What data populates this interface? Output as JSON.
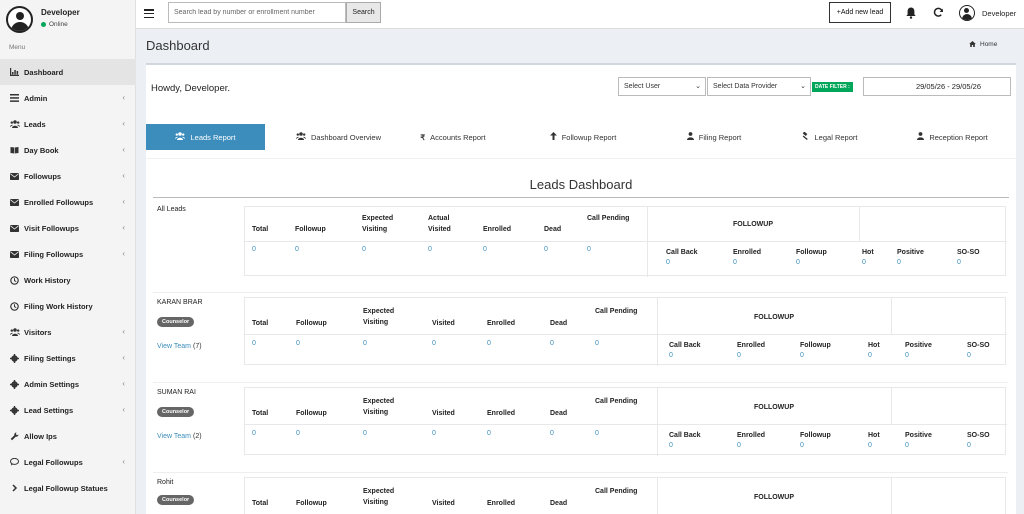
{
  "user": {
    "name": "Developer",
    "status": "Online"
  },
  "menu_header": "Menu",
  "sidebar": {
    "items": [
      {
        "label": "Dashboard",
        "icon": "dashboard-icon",
        "active": true,
        "chevron": false
      },
      {
        "label": "Admin",
        "icon": "list-icon",
        "chevron": true
      },
      {
        "label": "Leads",
        "icon": "users-icon",
        "chevron": true
      },
      {
        "label": "Day Book",
        "icon": "book-icon",
        "chevron": true
      },
      {
        "label": "Followups",
        "icon": "envelope-icon",
        "chevron": true
      },
      {
        "label": "Enrolled Followups",
        "icon": "envelope-icon",
        "chevron": true
      },
      {
        "label": "Visit Followups",
        "icon": "envelope-icon",
        "chevron": true
      },
      {
        "label": "Filing Followups",
        "icon": "envelope-icon",
        "chevron": true
      },
      {
        "label": "Work History",
        "icon": "clock-icon",
        "chevron": false
      },
      {
        "label": "Filing Work History",
        "icon": "clock-icon",
        "chevron": false
      },
      {
        "label": "Visitors",
        "icon": "users-icon",
        "chevron": true
      },
      {
        "label": "Filing Settings",
        "icon": "gear-icon",
        "chevron": true
      },
      {
        "label": "Admin Settings",
        "icon": "gear-icon",
        "chevron": true
      },
      {
        "label": "Lead Settings",
        "icon": "gear-icon",
        "chevron": true
      },
      {
        "label": "Allow Ips",
        "icon": "wrench-icon",
        "chevron": false
      },
      {
        "label": "Legal Followups",
        "icon": "comment-icon",
        "chevron": true
      },
      {
        "label": "Legal Followup Statues",
        "icon": "chevron-right-icon",
        "chevron": false
      }
    ]
  },
  "topbar": {
    "search_placeholder": "Search lead by number or enrollment number",
    "search_label": "Search",
    "add_lead_label": "+Add new lead",
    "user_label": "Developer"
  },
  "page": {
    "title": "Dashboard",
    "breadcrumb": "Home"
  },
  "filters": {
    "greeting": "Howdy, Developer.",
    "select_user": "Select User",
    "select_provider": "Select Data Provider",
    "date_filter_label": "DATE FILTER :",
    "date_range": "29/05/26 - 29/05/26"
  },
  "tabs": [
    {
      "label": "Leads Report",
      "icon": "users-icon",
      "active": true
    },
    {
      "label": "Dashboard Overview",
      "icon": "users-icon"
    },
    {
      "label": "Accounts Report",
      "icon": "rupee-icon"
    },
    {
      "label": "Followup Report",
      "icon": "arrow-up-icon"
    },
    {
      "label": "Filing Report",
      "icon": "user-icon"
    },
    {
      "label": "Legal Report",
      "icon": "gavel-icon"
    },
    {
      "label": "Reception Report",
      "icon": "user-icon"
    }
  ],
  "dashboard": {
    "title": "Leads Dashboard",
    "followup_header": "FOLLOWUP",
    "all_leads": {
      "name": "All Leads",
      "headers": [
        "Total",
        "Followup",
        "Expected Visiting",
        "Actual Visited",
        "Enrolled",
        "Dead",
        "Call Pending"
      ],
      "values": [
        "0",
        "0",
        "0",
        "0",
        "0",
        "0",
        "0"
      ],
      "followup_headers": [
        "Call Back",
        "Enrolled",
        "Followup",
        "Hot",
        "Positive",
        "SO-SO"
      ],
      "followup_values": [
        "0",
        "0",
        "0",
        "0",
        "0",
        "0"
      ]
    },
    "counselors": [
      {
        "name": "KARAN BRAR",
        "badge": "Counselor",
        "view_team": "View Team",
        "team_count": "(7)",
        "headers": [
          "Total",
          "Followup",
          "Expected Visiting",
          "Visited",
          "Enrolled",
          "Dead",
          "Call Pending"
        ],
        "values": [
          "0",
          "0",
          "0",
          "0",
          "0",
          "0",
          "0"
        ],
        "followup_headers": [
          "Call Back",
          "Enrolled",
          "Followup",
          "Hot",
          "Positive",
          "SO-SO"
        ],
        "followup_values": [
          "0",
          "0",
          "0",
          "0",
          "0",
          "0"
        ]
      },
      {
        "name": "SUMAN RAI",
        "badge": "Counselor",
        "view_team": "View Team",
        "team_count": "(2)",
        "headers": [
          "Total",
          "Followup",
          "Expected Visiting",
          "Visited",
          "Enrolled",
          "Dead",
          "Call Pending"
        ],
        "values": [
          "0",
          "0",
          "0",
          "0",
          "0",
          "0",
          "0"
        ],
        "followup_headers": [
          "Call Back",
          "Enrolled",
          "Followup",
          "Hot",
          "Positive",
          "SO-SO"
        ],
        "followup_values": [
          "0",
          "0",
          "0",
          "0",
          "0",
          "0"
        ]
      },
      {
        "name": "Rohit",
        "badge": "Counselor",
        "headers": [
          "Total",
          "Followup",
          "Expected Visiting",
          "Visited",
          "Enrolled",
          "Dead",
          "Call Pending"
        ],
        "followup_headers": []
      }
    ]
  }
}
